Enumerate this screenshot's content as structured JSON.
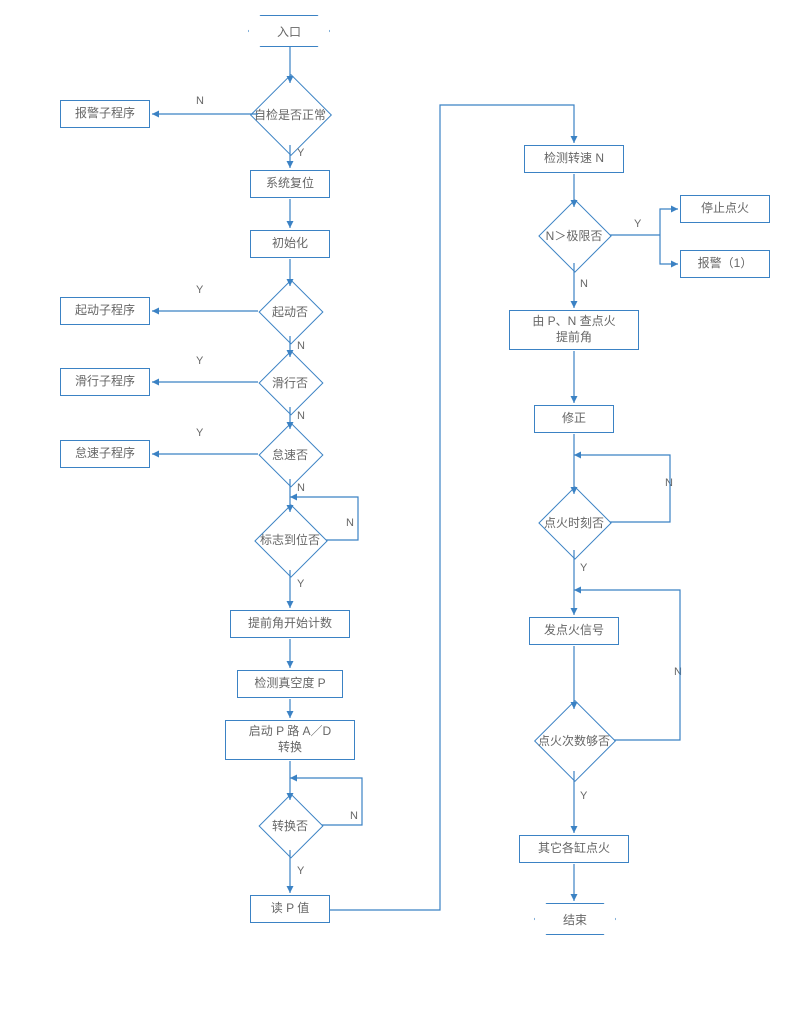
{
  "nodes": {
    "entry": "入口",
    "alarm_sub": "报警子程序",
    "selfcheck_decision": "自检是否正常",
    "system_reset": "系统复位",
    "init": "初始化",
    "start_sub": "起动子程序",
    "start_decision": "起动否",
    "slide_sub": "滑行子程序",
    "slide_decision": "滑行否",
    "idle_sub": "怠速子程序",
    "idle_decision": "怠速否",
    "flag_decision": "标志到位否",
    "advance_count": "提前角开始计数",
    "detect_vacuum": "检测真空度 P",
    "start_ad": "启动 P 路 A／D\n转换",
    "convert_decision": "转换否",
    "read_p": "读 P 值",
    "detect_n": "检测转速 N",
    "n_limit_decision": "N＞极限否",
    "stop_ignition": "停止点火",
    "alarm_1": "报警（1）",
    "pn_lookup": "由 P、N 查点火\n提前角",
    "correction": "修正",
    "ignition_time_decision": "点火时刻否",
    "send_signal": "发点火信号",
    "ignition_count_decision": "点火次数够否",
    "other_cylinders": "其它各缸点火",
    "end": "结束"
  },
  "labels": {
    "n": "N",
    "y": "Y"
  }
}
